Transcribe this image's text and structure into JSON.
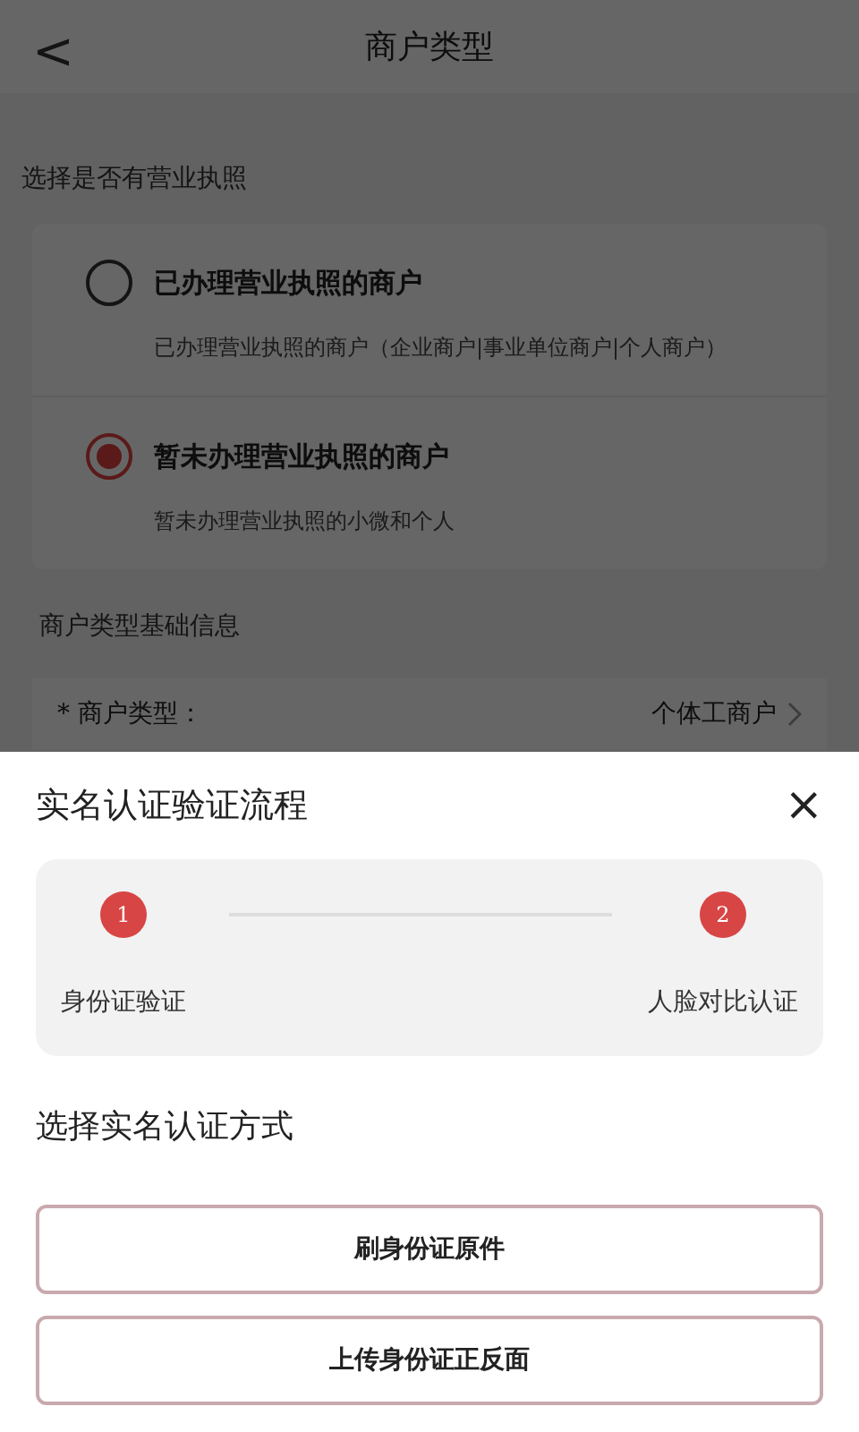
{
  "header": {
    "back": "<",
    "title": "商户类型"
  },
  "license_section": {
    "label": "选择是否有营业执照",
    "options": [
      {
        "title": "已办理营业执照的商户",
        "description": "已办理营业执照的商户（企业商户|事业单位商户|个人商户）",
        "selected": false
      },
      {
        "title": "暂未办理营业执照的商户",
        "description": "暂未办理营业执照的小微和个人",
        "selected": true
      }
    ]
  },
  "basic_section": {
    "label": "商户类型基础信息",
    "fields": [
      {
        "label": "* 商户类型：",
        "value": "个体工商户"
      }
    ]
  },
  "sheet": {
    "title": "实名认证验证流程",
    "close": "×",
    "steps": [
      {
        "number": "1",
        "label": "身份证验证"
      },
      {
        "number": "2",
        "label": "人脸对比认证"
      }
    ],
    "method_label": "选择实名认证方式",
    "buttons": [
      "刷身份证原件",
      "上传身份证正反面"
    ]
  }
}
